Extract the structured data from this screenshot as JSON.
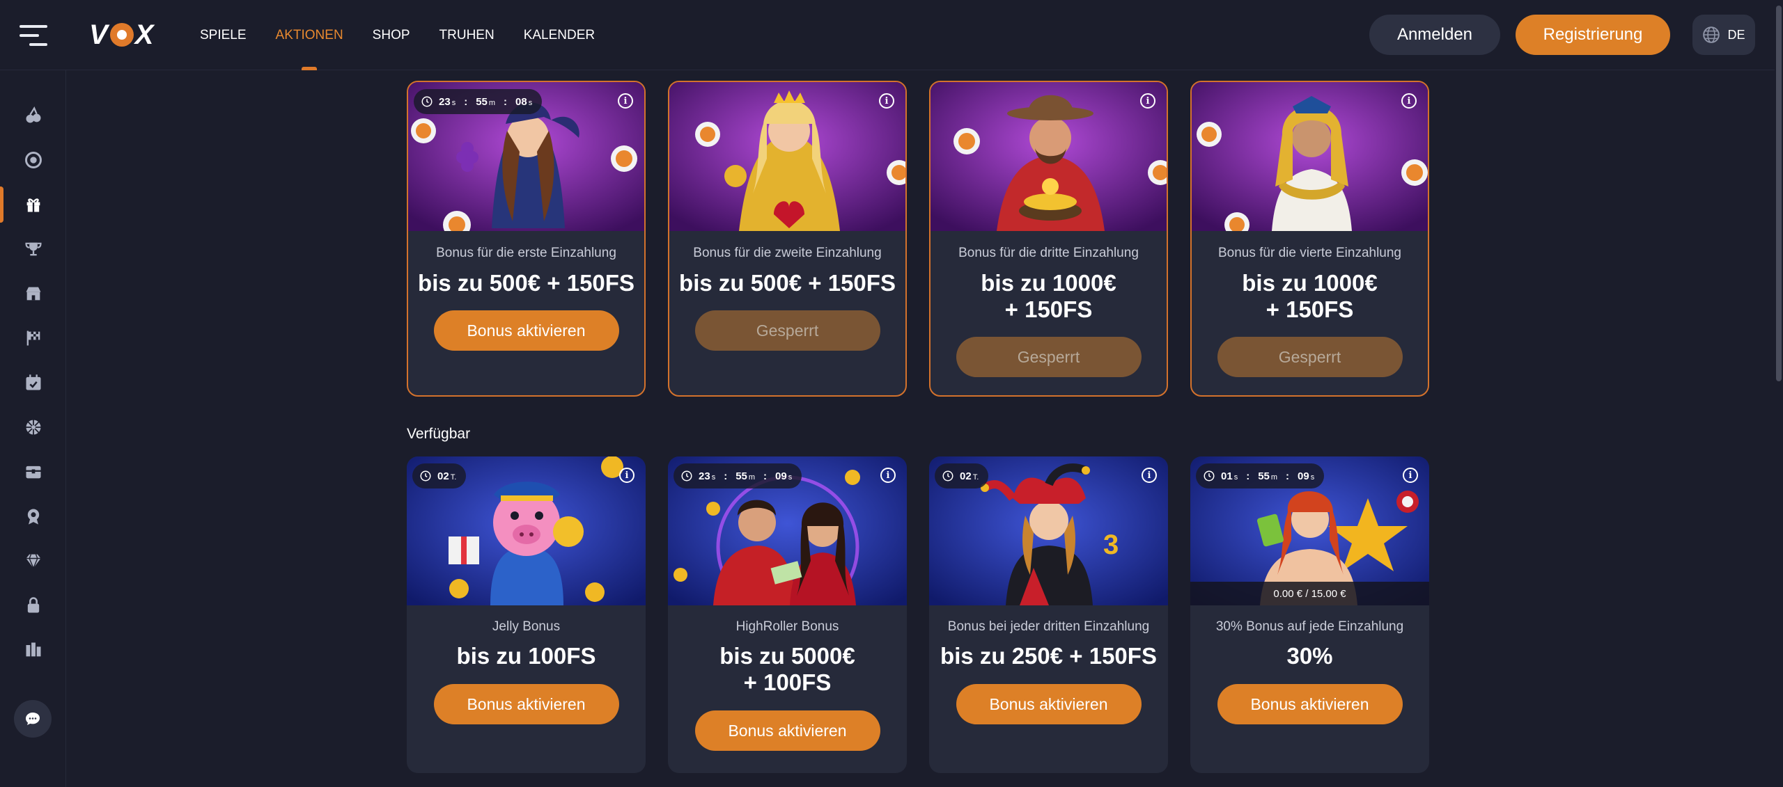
{
  "header": {
    "logo": "VOX",
    "nav": [
      {
        "label": "SPIELE",
        "active": false
      },
      {
        "label": "AKTIONEN",
        "active": true
      },
      {
        "label": "SHOP",
        "active": false
      },
      {
        "label": "TRUHEN",
        "active": false
      },
      {
        "label": "KALENDER",
        "active": false
      }
    ],
    "login_label": "Anmelden",
    "register_label": "Registrierung",
    "language": "DE"
  },
  "sidebar": {
    "items": [
      {
        "icon": "cherries-icon"
      },
      {
        "icon": "roulette-icon"
      },
      {
        "icon": "gift-icon",
        "active": true
      },
      {
        "icon": "trophy-icon"
      },
      {
        "icon": "shop-icon"
      },
      {
        "icon": "race-flag-icon"
      },
      {
        "icon": "calendar-check-icon"
      },
      {
        "icon": "wheel-icon"
      },
      {
        "icon": "chest-icon"
      },
      {
        "icon": "badge-icon"
      },
      {
        "icon": "diamond-icon"
      },
      {
        "icon": "lock-icon"
      },
      {
        "icon": "leaderboard-icon"
      }
    ],
    "chat_icon": "chat-icon"
  },
  "colors": {
    "accent": "#dd8027",
    "background": "#1b1d2b",
    "card": "#262a3a"
  },
  "welcome_cards": [
    {
      "timer": {
        "h": "23",
        "hu": "s",
        "m": "55",
        "mu": "m",
        "s": "08",
        "su": "s"
      },
      "subtitle": "Bonus für die erste Einzahlung",
      "amount_line1": "bis zu 500€ + 150FS",
      "amount_line2": "",
      "button": "Bonus aktivieren",
      "enabled": true
    },
    {
      "subtitle": "Bonus für die zweite Einzahlung",
      "amount_line1": "bis zu 500€ + 150FS",
      "amount_line2": "",
      "button": "Gesperrt",
      "enabled": false
    },
    {
      "subtitle": "Bonus für die dritte Einzahlung",
      "amount_line1": "bis zu 1000€",
      "amount_line2": "+ 150FS",
      "button": "Gesperrt",
      "enabled": false
    },
    {
      "subtitle": "Bonus für die vierte Einzahlung",
      "amount_line1": "bis zu 1000€",
      "amount_line2": "+ 150FS",
      "button": "Gesperrt",
      "enabled": false
    }
  ],
  "available_section_title": "Verfügbar",
  "available_cards": [
    {
      "timer_days": "02",
      "timer_days_unit": "T.",
      "subtitle": "Jelly Bonus",
      "amount_line1": "bis zu 100FS",
      "amount_line2": "",
      "button": "Bonus aktivieren"
    },
    {
      "timer": {
        "h": "23",
        "hu": "s",
        "m": "55",
        "mu": "m",
        "s": "09",
        "su": "s"
      },
      "subtitle": "HighRoller Bonus",
      "amount_line1": "bis zu 5000€",
      "amount_line2": "+ 100FS",
      "button": "Bonus aktivieren"
    },
    {
      "timer_days": "02",
      "timer_days_unit": "T.",
      "subtitle": "Bonus bei jeder dritten Einzahlung",
      "amount_line1": "bis zu 250€ + 150FS",
      "amount_line2": "",
      "button": "Bonus aktivieren"
    },
    {
      "timer": {
        "h": "01",
        "hu": "s",
        "m": "55",
        "mu": "m",
        "s": "09",
        "su": "s"
      },
      "progress": "0.00 € / 15.00 €",
      "subtitle": "30% Bonus auf jede Einzahlung",
      "amount_line1": "30%",
      "amount_line2": "",
      "button": "Bonus aktivieren"
    }
  ]
}
